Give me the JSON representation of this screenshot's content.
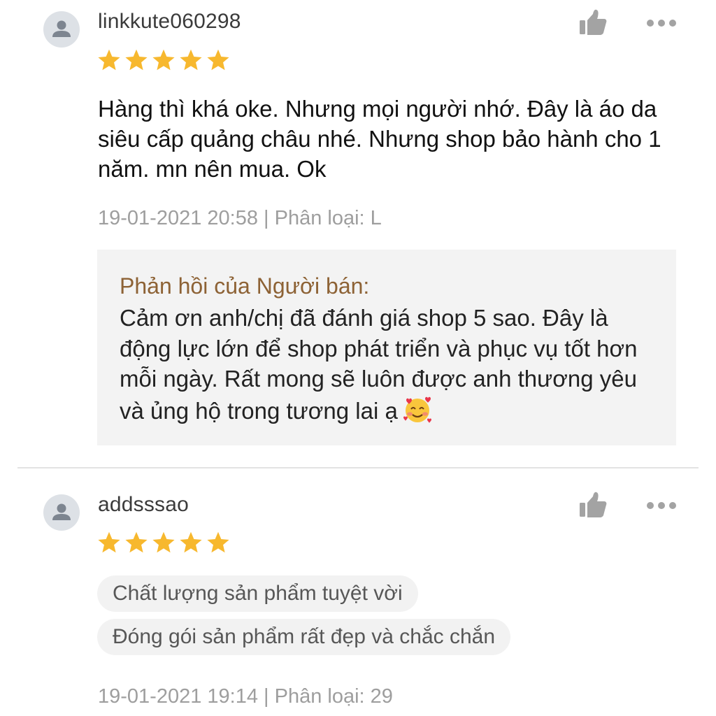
{
  "reviews": [
    {
      "username": "linkkute060298",
      "rating": 5,
      "comment": "Hàng thì khá oke. Nhưng mọi người nhớ. Đây là áo da siêu cấp quảng châu nhé.  Nhưng shop bảo hành cho 1 năm. mn nên mua. Ok",
      "meta": "19-01-2021 20:58 | Phân loại: L",
      "seller_reply": {
        "title": "Phản hồi của Người bán:",
        "text": "Cảm ơn anh/chị đã đánh giá shop 5 sao. Đây là động lực lớn để shop phát triển và phục vụ tốt hơn mỗi ngày. Rất mong sẽ luôn được anh thương yêu và ủng hộ trong tương lai ạ",
        "emoji": "smiling-face-with-hearts"
      },
      "icons": {
        "avatar": "person-icon",
        "like": "thumbs-up-icon",
        "more": "more-dots-icon"
      }
    },
    {
      "username": "addsssao",
      "rating": 5,
      "tags": [
        "Chất lượng sản phẩm tuyệt vời",
        "Đóng gói sản phẩm rất đẹp và chắc chắn"
      ],
      "meta": "19-01-2021 19:14 | Phân loại: 29",
      "icons": {
        "avatar": "person-icon",
        "like": "thumbs-up-icon",
        "more": "more-dots-icon"
      }
    }
  ],
  "colors": {
    "star": "#f7b82e",
    "seller_reply_title": "#8d6235",
    "meta_text": "#9e9e9e",
    "icon_gray": "#a3a3a3",
    "reply_background": "#f3f3f3",
    "tag_background": "#f2f2f2"
  }
}
